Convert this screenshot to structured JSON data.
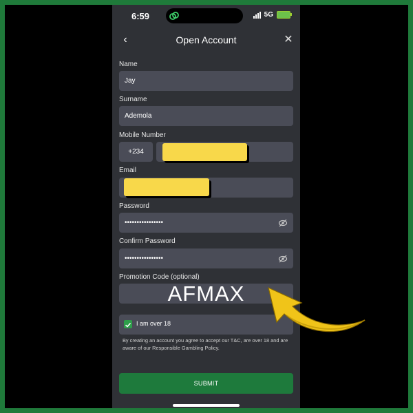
{
  "status_bar": {
    "time": "6:59",
    "network": "5G"
  },
  "nav": {
    "title": "Open Account",
    "back_icon": "chevron-left-icon",
    "close_icon": "close-icon"
  },
  "form": {
    "name_label": "Name",
    "name_value": "Jay",
    "surname_label": "Surname",
    "surname_value": "Ademola",
    "mobile_label": "Mobile Number",
    "mobile_prefix": "+234",
    "email_label": "Email",
    "password_label": "Password",
    "password_value": "••••••••••••••••",
    "confirm_label": "Confirm Password",
    "confirm_value": "••••••••••••••••",
    "promo_label": "Promotion Code (optional)",
    "promo_value": "AFMAX",
    "age_check_label": "I am over 18",
    "age_checked": true,
    "terms_text": "By creating an account you agree to accept our T&C, are over 18 and are aware of our Responsible Gambling Policy.",
    "submit_label": "SUBMIT"
  },
  "colors": {
    "frame": "#1f7a3a",
    "background": "#2f3136",
    "field": "#4a4c57",
    "submit": "#1e7a3c",
    "highlight": "#f8d84a",
    "arrow": "#f0c419"
  }
}
